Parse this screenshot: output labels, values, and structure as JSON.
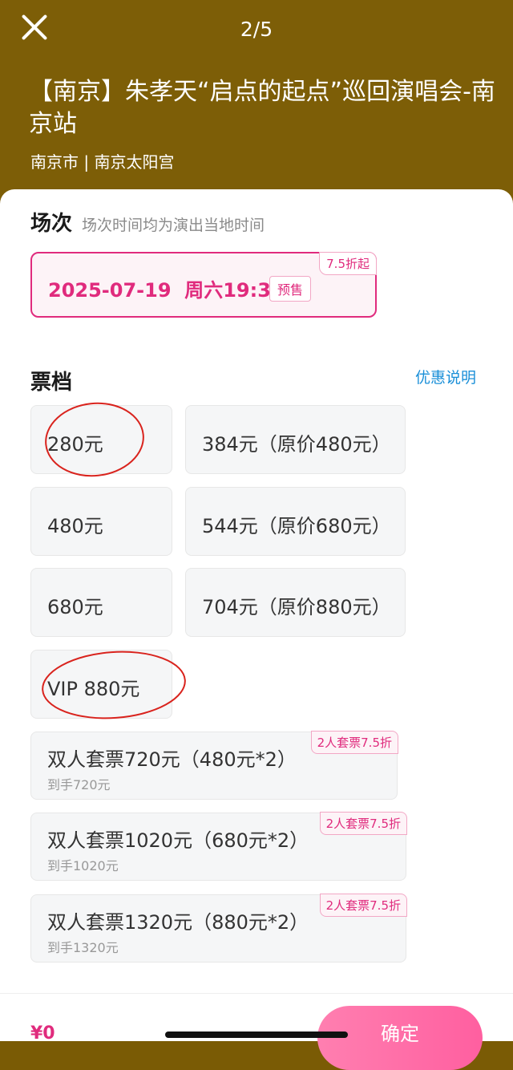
{
  "header": {
    "counter": "2/5",
    "title": "【南京】朱孝天“启点的起点”巡回演唱会-南京站",
    "venue": "南京市 | 南京太阳宫"
  },
  "session": {
    "title": "场次",
    "note": "场次时间均为演出当地时间",
    "date": "2025-07-19  周六19:30",
    "status": "预售",
    "discount": "7.5折起"
  },
  "tickets": {
    "title": "票档",
    "promo_link": "优惠说明",
    "tiers": [
      "280元",
      "384元（原价480元）",
      "480元",
      "544元（原价680元）",
      "680元",
      "704元（原价880元）",
      "VIP 880元"
    ],
    "packages": [
      {
        "label": "双人套票720元（480元*2）",
        "sub": "到手720元",
        "tag": "2人套票7.5折"
      },
      {
        "label": "双人套票1020元（680元*2）",
        "sub": "到手1020元",
        "tag": "2人套票7.5折"
      },
      {
        "label": "双人套票1320元（880元*2）",
        "sub": "到手1320元",
        "tag": "2人套票7.5折"
      }
    ]
  },
  "footer": {
    "total": "¥0",
    "confirm": "确定"
  },
  "colors": {
    "header_bg": "#7d5e07",
    "accent": "#e02b7d",
    "link": "#1a8fd8",
    "annotation": "#d9231d"
  }
}
